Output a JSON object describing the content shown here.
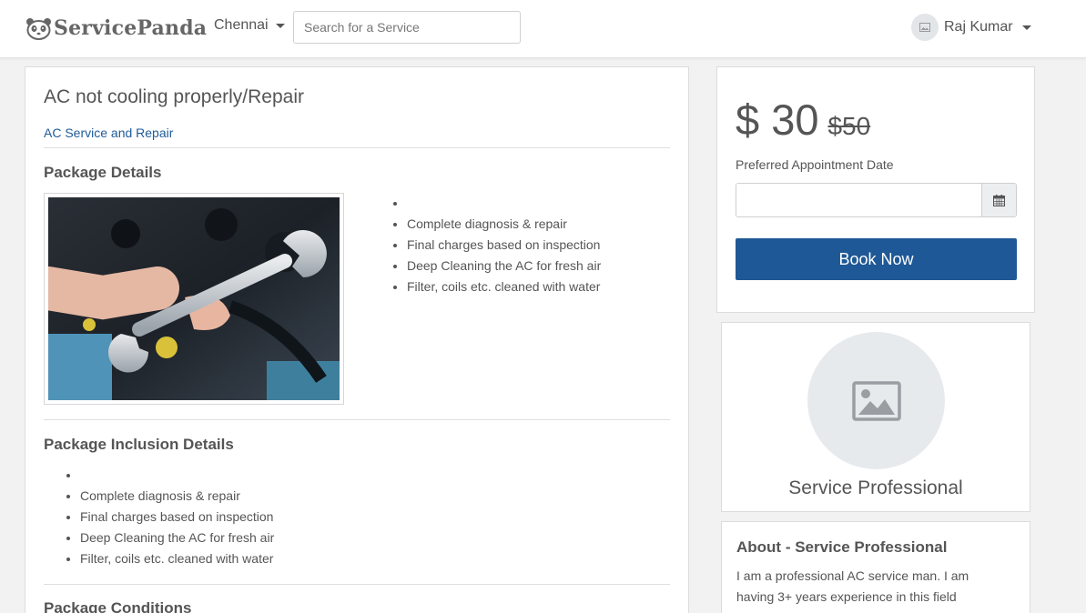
{
  "nav": {
    "brand": "ServicePanda",
    "city": "Chennai",
    "search_placeholder": "Search for a Service",
    "user_name": "Raj Kumar"
  },
  "service": {
    "title": "AC not cooling properly/Repair",
    "category": "AC Service and Repair",
    "package_details_heading": "Package Details",
    "package_details_items": [
      "",
      "Complete diagnosis & repair",
      "Final charges based on inspection",
      "Deep Cleaning the AC for fresh air",
      "Filter, coils etc. cleaned with water"
    ],
    "inclusion_heading": "Package Inclusion Details",
    "inclusion_items": [
      "",
      "Complete diagnosis & repair",
      "Final charges based on inspection",
      "Deep Cleaning the AC for fresh air",
      "Filter, coils etc. cleaned with water"
    ],
    "conditions_heading": "Package Conditions"
  },
  "booking": {
    "price": "$ 30",
    "old_price": "$50",
    "date_label": "Preferred Appointment Date",
    "date_value": "",
    "book_label": "Book Now"
  },
  "professional": {
    "name": "Service Professional",
    "about_heading": "About - Service Professional",
    "about_text": "I am a professional AC service man. I am having 3+ years experience in this field"
  },
  "colors": {
    "accent": "#1f5896",
    "link": "#1f5b99",
    "text": "#555555"
  }
}
